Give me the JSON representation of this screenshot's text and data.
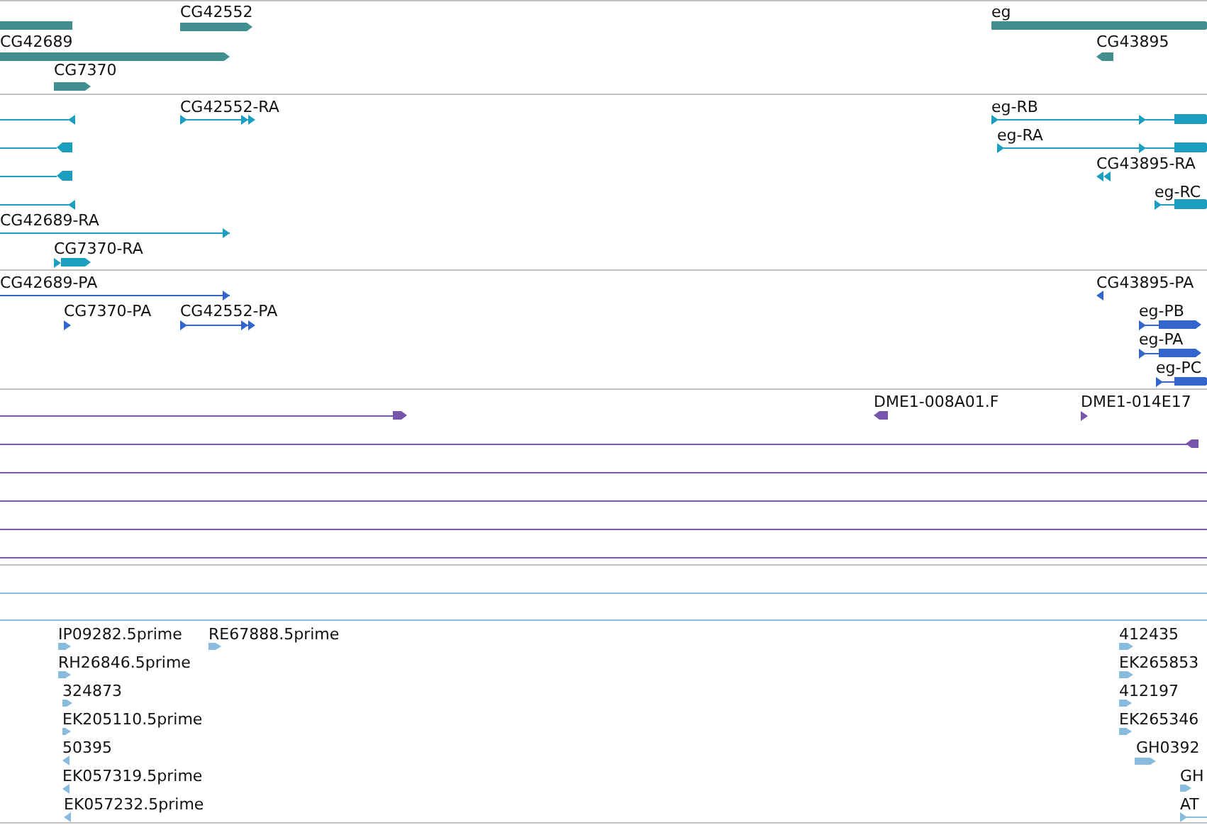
{
  "tracks": [
    {
      "color": "#418f91",
      "features": [
        {
          "kind": "arrow",
          "reverse": true
        },
        {
          "kind": "arrow",
          "label": "CG42552",
          "reverse": false
        },
        {
          "kind": "arrow",
          "label": "CG42689",
          "reverse": false
        },
        {
          "kind": "arrow",
          "label": "CG7370",
          "reverse": false
        },
        {
          "kind": "arrow",
          "label": "eg",
          "reverse": false
        },
        {
          "kind": "arrow",
          "label": "CG43895",
          "reverse": true
        }
      ]
    },
    {
      "color": "#1a9fc0",
      "features": [
        {
          "kind": "arrow",
          "reverse": true
        },
        {
          "kind": "arrow",
          "reverse": true
        },
        {
          "kind": "arrow",
          "reverse": true
        },
        {
          "kind": "arrow",
          "reverse": true
        },
        {
          "kind": "arrow",
          "label": "CG42552-RA",
          "reverse": false
        },
        {
          "kind": "arrow",
          "label": "CG42689-RA",
          "reverse": false
        },
        {
          "kind": "arrow",
          "label": "CG7370-RA",
          "reverse": false
        },
        {
          "kind": "arrow",
          "label": "eg-RB",
          "reverse": false
        },
        {
          "kind": "arrow",
          "label": "eg-RA",
          "reverse": false
        },
        {
          "kind": "arrow",
          "label": "CG43895-RA",
          "reverse": true
        },
        {
          "kind": "arrow",
          "label": "eg-RC",
          "reverse": false
        }
      ]
    },
    {
      "color": "#3366cc",
      "features": [
        {
          "kind": "arrow",
          "label": "CG42689-PA",
          "reverse": false
        },
        {
          "kind": "arrow",
          "label": "CG7370-PA",
          "reverse": false
        },
        {
          "kind": "arrow",
          "label": "CG42552-PA",
          "reverse": false
        },
        {
          "kind": "arrow",
          "label": "CG43895-PA",
          "reverse": true
        },
        {
          "kind": "arrow",
          "label": "eg-PB",
          "reverse": false
        },
        {
          "kind": "arrow",
          "label": "eg-PA",
          "reverse": false
        },
        {
          "kind": "arrow",
          "label": "eg-PC",
          "reverse": false
        }
      ]
    },
    {
      "color": "#7755aa",
      "features": [
        {
          "kind": "arrow",
          "reverse": false
        },
        {
          "kind": "arrow",
          "label": "DME1-008A01.F",
          "reverse": true
        },
        {
          "kind": "arrow",
          "label": "DME1-014E17",
          "reverse": false
        },
        {
          "kind": "arrow",
          "reverse": true
        },
        {
          "kind": "line"
        },
        {
          "kind": "line"
        },
        {
          "kind": "line"
        },
        {
          "kind": "line"
        }
      ]
    },
    {
      "color": "#88bbdd",
      "features": [
        {
          "kind": "line"
        },
        {
          "kind": "line"
        },
        {
          "kind": "arrow",
          "label": "IP09282.5prime",
          "reverse": false
        },
        {
          "kind": "arrow",
          "label": "RE67888.5prime",
          "reverse": false
        },
        {
          "kind": "arrow",
          "label": "RH26846.5prime",
          "reverse": false
        },
        {
          "kind": "arrow",
          "label": "324873",
          "reverse": false
        },
        {
          "kind": "arrow",
          "label": "EK205110.5prime",
          "reverse": false
        },
        {
          "kind": "arrow",
          "label": "50395",
          "reverse": true
        },
        {
          "kind": "arrow",
          "label": "EK057319.5prime",
          "reverse": true
        },
        {
          "kind": "arrow",
          "label": "EK057232.5prime",
          "reverse": true
        },
        {
          "kind": "arrow",
          "label": "412435",
          "reverse": false
        },
        {
          "kind": "arrow",
          "label": "EK265853",
          "reverse": false
        },
        {
          "kind": "arrow",
          "label": "412197",
          "reverse": false
        },
        {
          "kind": "arrow",
          "label": "EK265346",
          "reverse": false
        },
        {
          "kind": "arrow",
          "label": "GH0392",
          "reverse": false
        },
        {
          "kind": "arrow",
          "label": "GH",
          "reverse": false
        },
        {
          "kind": "arrow",
          "label": "AT",
          "reverse": false
        }
      ]
    }
  ]
}
